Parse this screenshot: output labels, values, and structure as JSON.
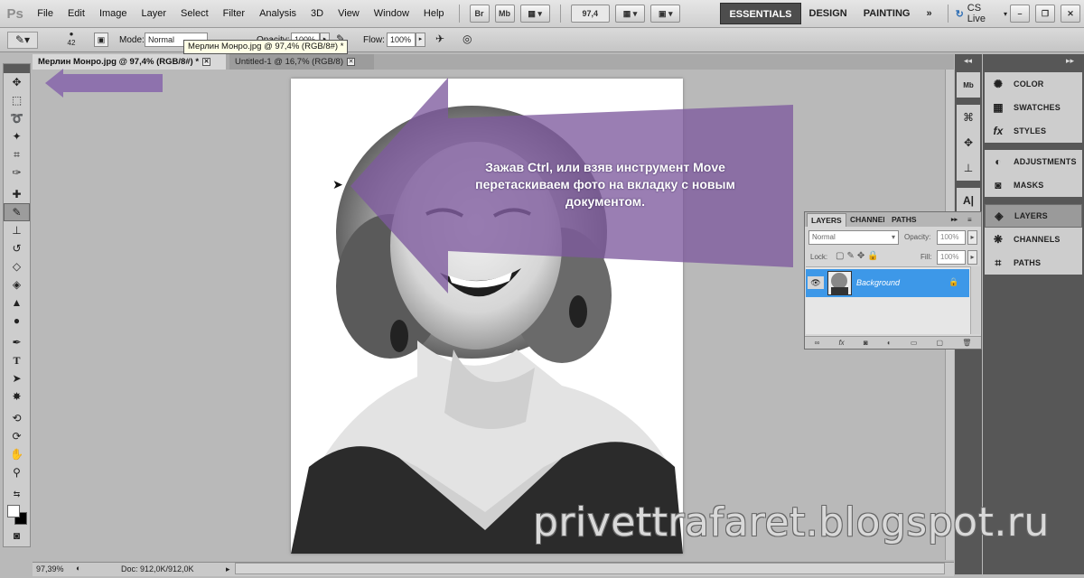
{
  "app": {
    "logo": "Ps"
  },
  "menu": [
    "File",
    "Edit",
    "Image",
    "Layer",
    "Select",
    "Filter",
    "Analysis",
    "3D",
    "View",
    "Window",
    "Help"
  ],
  "menubar_buttons": {
    "bridge": "Br",
    "minibridge": "Mb",
    "zoom": "97,4"
  },
  "workspaces": [
    "ESSENTIALS",
    "DESIGN",
    "PAINTING"
  ],
  "cs_live": "CS Live",
  "options": {
    "brush_size": "42",
    "mode_label": "Mode:",
    "mode_value": "Normal",
    "opacity_label": "Opacity:",
    "opacity_value": "100%",
    "flow_label": "Flow:",
    "flow_value": "100%"
  },
  "tooltip": "Мерлин Монро.jpg @ 97,4% (RGB/8#) *",
  "tabs": [
    {
      "label": "Мерлин Монро.jpg @ 97,4% (RGB/8#) *"
    },
    {
      "label": "Untitled-1 @ 16,7% (RGB/8)"
    }
  ],
  "callout": "Зажав Ctrl, или взяв инструмент Move перетаскиваем фото на вкладку с новым документом.",
  "watermark": "privettrafaret.blogspot.ru",
  "status": {
    "zoom": "97,39%",
    "doc": "Doc: 912,0K/912,0K"
  },
  "panel_dock": {
    "items": [
      "COLOR",
      "SWATCHES",
      "STYLES",
      "ADJUSTMENTS",
      "MASKS",
      "LAYERS",
      "CHANNELS",
      "PATHS"
    ]
  },
  "layers_panel": {
    "tabs": [
      "LAYERS",
      "CHANNELS",
      "PATHS"
    ],
    "blend_mode": "Normal",
    "opacity_label": "Opacity:",
    "opacity_value": "100%",
    "lock_label": "Lock:",
    "fill_label": "Fill:",
    "fill_value": "100%",
    "layer_name": "Background"
  },
  "colors": {
    "accent": "#3d98e8",
    "arrow": "#8a6aac",
    "workspace_active": "#4d4d4d"
  }
}
